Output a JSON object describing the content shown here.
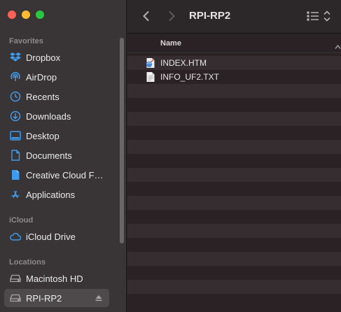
{
  "window": {
    "title": "RPI-RP2"
  },
  "sidebar": {
    "favorites_label": "Favorites",
    "favorites": [
      {
        "label": "Dropbox",
        "icon": "dropbox-icon"
      },
      {
        "label": "AirDrop",
        "icon": "airdrop-icon"
      },
      {
        "label": "Recents",
        "icon": "recents-icon"
      },
      {
        "label": "Downloads",
        "icon": "downloads-icon"
      },
      {
        "label": "Desktop",
        "icon": "desktop-icon"
      },
      {
        "label": "Documents",
        "icon": "documents-icon"
      },
      {
        "label": "Creative Cloud F…",
        "icon": "creative-cloud-files-icon"
      },
      {
        "label": "Applications",
        "icon": "applications-icon"
      }
    ],
    "icloud_label": "iCloud",
    "icloud": [
      {
        "label": "iCloud Drive",
        "icon": "icloud-icon"
      }
    ],
    "locations_label": "Locations",
    "locations": [
      {
        "label": "Macintosh HD",
        "icon": "disk-icon"
      },
      {
        "label": "RPI-RP2",
        "icon": "disk-icon",
        "selected": true,
        "ejectable": true
      }
    ]
  },
  "list": {
    "column_name": "Name",
    "files": [
      {
        "name": "INDEX.HTM",
        "icon": "html-file-icon"
      },
      {
        "name": "INFO_UF2.TXT",
        "icon": "text-file-icon"
      }
    ]
  },
  "colors": {
    "accent": "#3d9cf0",
    "sidebar_bg": "#393436",
    "content_bg": "#2a2224",
    "row_alt": "#352d2f"
  }
}
